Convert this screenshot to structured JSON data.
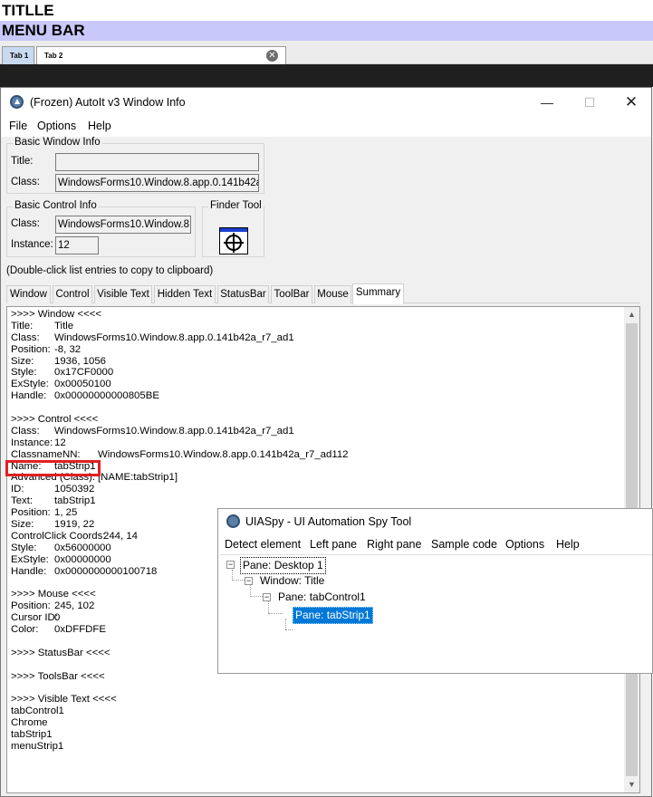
{
  "app": {
    "title": "TITLLE",
    "menubar_label": "MENU BAR",
    "tabs": [
      {
        "label": "Tab 1"
      },
      {
        "label": "Tab 2"
      }
    ],
    "close_glyph": "✕"
  },
  "autoit": {
    "title": "(Frozen) AutoIt v3 Window Info",
    "controls": {
      "minimize": "—",
      "maximize": "☐",
      "close": "✕"
    },
    "menu": [
      "File",
      "Options",
      "Help"
    ],
    "basic_window_info": {
      "group_label": "Basic Window Info",
      "title_label": "Title:",
      "title_value": "",
      "class_label": "Class:",
      "class_value": "WindowsForms10.Window.8.app.0.141b42a_r"
    },
    "basic_control_info": {
      "group_label": "Basic Control Info",
      "class_label": "Class:",
      "class_value": "WindowsForms10.Window.8.a",
      "instance_label": "Instance:",
      "instance_value": "12"
    },
    "finder_tool_label": "Finder Tool",
    "clipboard_hint": "(Double-click list entries to copy to clipboard)",
    "tabs": [
      "Window",
      "Control",
      "Visible Text",
      "Hidden Text",
      "StatusBar",
      "ToolBar",
      "Mouse",
      "Summary"
    ],
    "active_tab": "Summary",
    "summary_lines": [
      {
        "label": ">>>> Window <<<<",
        "value": ""
      },
      {
        "label": "Title:",
        "value": "Title"
      },
      {
        "label": "Class:",
        "value": "WindowsForms10.Window.8.app.0.141b42a_r7_ad1"
      },
      {
        "label": "Position:",
        "value": "-8, 32"
      },
      {
        "label": "Size:",
        "value": "1936, 1056"
      },
      {
        "label": "Style:",
        "value": "0x17CF0000"
      },
      {
        "label": "ExStyle:",
        "value": "0x00050100"
      },
      {
        "label": "Handle:",
        "value": "0x00000000000805BE"
      },
      {
        "label": "",
        "value": ""
      },
      {
        "label": ">>>> Control <<<<",
        "value": ""
      },
      {
        "label": "Class:",
        "value": "WindowsForms10.Window.8.app.0.141b42a_r7_ad1"
      },
      {
        "label": "Instance:",
        "value": "12"
      },
      {
        "label": "ClassnameNN:",
        "value": "WindowsForms10.Window.8.app.0.141b42a_r7_ad112",
        "wide": true
      },
      {
        "label": "Name:",
        "value": "tabStrip1"
      },
      {
        "label": "Advanced (Class):",
        "value": "[NAME:tabStrip1]",
        "wide": true
      },
      {
        "label": "ID:",
        "value": "1050392"
      },
      {
        "label": "Text:",
        "value": "tabStrip1"
      },
      {
        "label": "Position:",
        "value": "1, 25"
      },
      {
        "label": "Size:",
        "value": "1919, 22"
      },
      {
        "label": "ControlClick Coords:",
        "value": "244, 14",
        "inline": true
      },
      {
        "label": "Style:",
        "value": "0x56000000"
      },
      {
        "label": "ExStyle:",
        "value": "0x00000000"
      },
      {
        "label": "Handle:",
        "value": "0x0000000000100718"
      },
      {
        "label": "",
        "value": ""
      },
      {
        "label": ">>>> Mouse <<<<",
        "value": ""
      },
      {
        "label": "Position:",
        "value": "245, 102"
      },
      {
        "label": "Cursor ID:",
        "value": "0"
      },
      {
        "label": "Color:",
        "value": "0xDFFDFE"
      },
      {
        "label": "",
        "value": ""
      },
      {
        "label": ">>>> StatusBar <<<<",
        "value": ""
      },
      {
        "label": "",
        "value": ""
      },
      {
        "label": ">>>> ToolsBar <<<<",
        "value": ""
      },
      {
        "label": "",
        "value": ""
      },
      {
        "label": ">>>> Visible Text <<<<",
        "value": ""
      },
      {
        "label": "tabControl1",
        "value": ""
      },
      {
        "label": "Chrome",
        "value": ""
      },
      {
        "label": "tabStrip1",
        "value": ""
      },
      {
        "label": "menuStrip1",
        "value": ""
      }
    ],
    "scroll_up": "▲",
    "scroll_down": "▼"
  },
  "uiaspy": {
    "title": "UIASpy - UI Automation Spy Tool",
    "menu": [
      "Detect element",
      "Left pane",
      "Right pane",
      "Sample code",
      "Options",
      "Help"
    ],
    "tree": [
      {
        "label": "Pane: Desktop 1",
        "expander": "−"
      },
      {
        "label": "Window: Title",
        "expander": "−"
      },
      {
        "label": "Pane: tabControl1",
        "expander": "−"
      },
      {
        "label": "Pane: tabStrip1",
        "expander": ""
      }
    ],
    "selected_node": "Pane: tabStrip1",
    "accent_color": "#0078d7"
  },
  "colors": {
    "menubar_bg": "#c8c8fa",
    "highlight_border": "#e02020",
    "dark_band": "#1f1f1f"
  }
}
